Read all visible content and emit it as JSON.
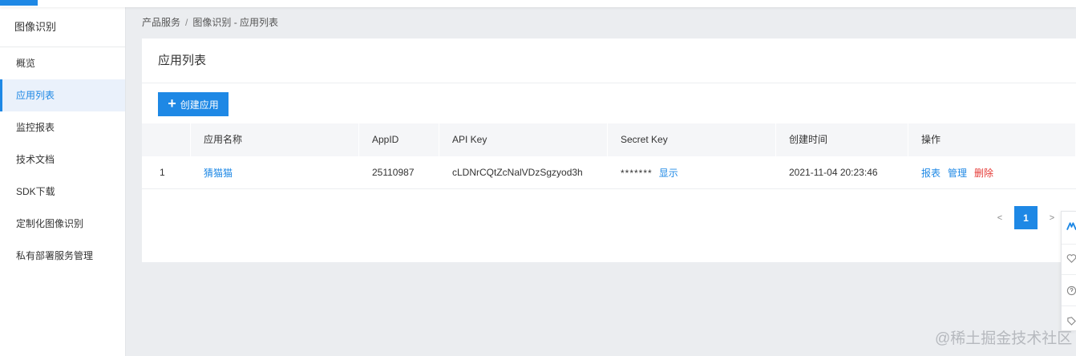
{
  "sidebar": {
    "title": "图像识别",
    "items": [
      {
        "label": "概览"
      },
      {
        "label": "应用列表"
      },
      {
        "label": "监控报表"
      },
      {
        "label": "技术文档"
      },
      {
        "label": "SDK下载"
      },
      {
        "label": "定制化图像识别"
      },
      {
        "label": "私有部署服务管理"
      }
    ]
  },
  "breadcrumb": {
    "root": "产品服务",
    "separator": "/",
    "current": "图像识别 - 应用列表"
  },
  "main": {
    "title": "应用列表",
    "create_button": "创建应用"
  },
  "table": {
    "headers": [
      "",
      "应用名称",
      "AppID",
      "API Key",
      "Secret Key",
      "创建时间",
      "操作"
    ],
    "rows": [
      {
        "index": "1",
        "name": "猜猫猫",
        "app_id": "25110987",
        "api_key": "cLDNrCQtZcNalVDzSgzyod3h",
        "secret_mask": "*******",
        "secret_show": "显示",
        "created": "2021-11-04 20:23:46",
        "ops": {
          "report": "报表",
          "manage": "管理",
          "delete": "删除"
        }
      }
    ]
  },
  "pagination": {
    "prev": "<",
    "current": "1",
    "next": ">"
  },
  "watermark": "@稀土掘金技术社区",
  "colors": {
    "accent": "#1e88e5",
    "danger": "#e53935",
    "background": "#ebedf0"
  },
  "icons": [
    "plus-icon",
    "logo-icon",
    "heart-icon",
    "help-icon",
    "tag-icon"
  ]
}
